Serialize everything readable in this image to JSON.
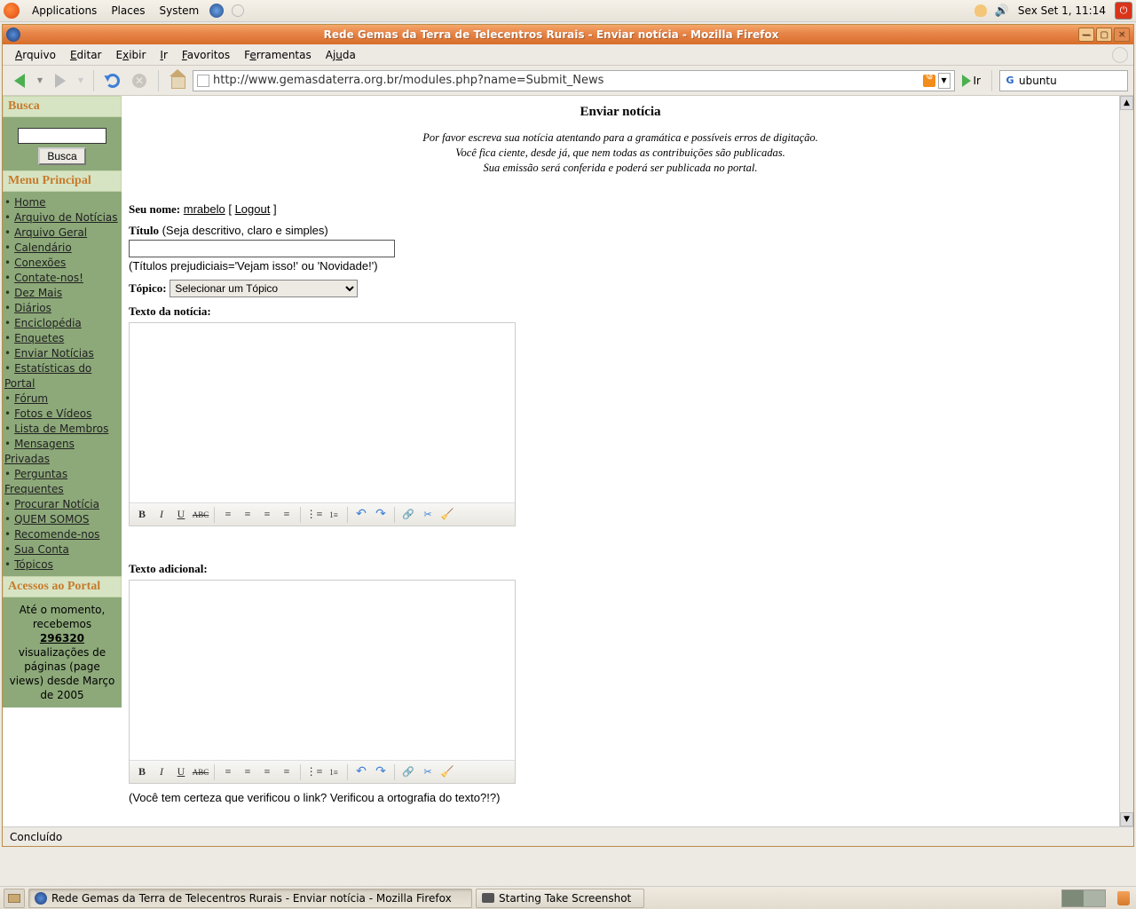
{
  "top_panel": {
    "apps": "Applications",
    "places": "Places",
    "system": "System",
    "clock": "Sex Set  1, 11:14"
  },
  "window": {
    "title": "Rede Gemas da Terra de Telecentros Rurais - Enviar notícia - Mozilla Firefox"
  },
  "menubar": {
    "arquivo": "Arquivo",
    "editar": "Editar",
    "exibir": "Exibir",
    "ir": "Ir",
    "favoritos": "Favoritos",
    "ferramentas": "Ferramentas",
    "ajuda": "Ajuda"
  },
  "navbar": {
    "url": "http://www.gemasdaterra.org.br/modules.php?name=Submit_News",
    "go_label": "Ir",
    "search_value": "ubuntu"
  },
  "sidebar": {
    "busca_title": "Busca",
    "busca_btn": "Busca",
    "menu_title": "Menu Principal",
    "items": [
      {
        "label": "Home"
      },
      {
        "label": "Arquivo de Notícias"
      },
      {
        "label": "Arquivo Geral"
      },
      {
        "label": "Calendário"
      },
      {
        "label": "Conexões"
      },
      {
        "label": "Contate-nos!"
      },
      {
        "label": "Dez Mais"
      },
      {
        "label": "Diários"
      },
      {
        "label": "Enciclopédia"
      },
      {
        "label": "Enquetes"
      },
      {
        "label": "Enviar Notícias"
      },
      {
        "label": "Estatísticas do Portal"
      },
      {
        "label": "Fórum"
      },
      {
        "label": "Fotos e Vídeos"
      },
      {
        "label": "Lista de Membros"
      },
      {
        "label": "Mensagens Privadas"
      },
      {
        "label": "Perguntas Frequentes"
      },
      {
        "label": "Procurar Notícia"
      },
      {
        "label": "QUEM SOMOS"
      },
      {
        "label": "Recomende-nos"
      },
      {
        "label": "Sua Conta"
      },
      {
        "label": "Tópicos"
      }
    ],
    "acessos_title": "Acessos ao Portal",
    "visits_l1": "Até o momento, recebemos",
    "visits_num": "296320",
    "visits_l2": "visualizações de páginas (page views) desde Março de 2005"
  },
  "form": {
    "page_title": "Enviar notícia",
    "instr1": "Por favor escreva sua notícia atentando para a gramática e possíveis erros de digitação.",
    "instr2": "Você fica ciente, desde já, que nem todas as contribuições são publicadas.",
    "instr3": "Sua emissão será conferida e poderá ser publicada no portal.",
    "name_label": "Seu nome:",
    "username": "mrabelo",
    "logout": "Logout",
    "titulo_label": "Título",
    "titulo_hint1": "(Seja descritivo, claro e simples)",
    "titulo_hint2": "(Títulos prejudiciais='Vejam isso!' ou 'Novidade!')",
    "topico_label": "Tópico:",
    "topico_option": "Selecionar um Tópico",
    "texto_label": "Texto da notícia:",
    "adicional_label": "Texto adicional:",
    "check_hint": "(Você tem certeza que verificou o link? Verificou a ortografia do texto?!?)"
  },
  "statusbar": {
    "text": "Concluído"
  },
  "taskbar": {
    "task1": "Rede Gemas da Terra de Telecentros Rurais - Enviar notícia - Mozilla Firefox",
    "task2": "Starting Take Screenshot"
  }
}
